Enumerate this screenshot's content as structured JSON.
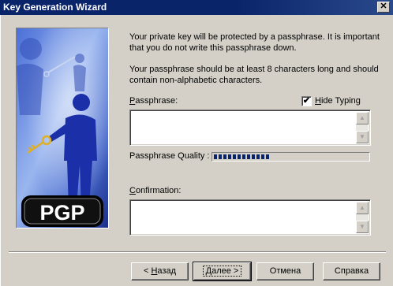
{
  "window": {
    "title": "Key Generation Wizard",
    "close_glyph": "✕"
  },
  "side_image": {
    "logo_text": "PGP"
  },
  "intro": {
    "line1": "Your private key will be protected by a passphrase.  It is important",
    "line2": "that you do not write this passphrase down.",
    "line3": "Your passphrase should be at least 8 characters long and should",
    "line4": "contain non-alphabetic characters."
  },
  "passphrase": {
    "label_first": "P",
    "label_rest": "assphrase:",
    "value": ""
  },
  "hide_typing": {
    "label_first": "H",
    "label_rest": "ide Typing",
    "checked": true,
    "check_glyph": "✔"
  },
  "quality": {
    "label": "Passphrase Quality :",
    "fraction": 0.36
  },
  "confirmation": {
    "label_first": "C",
    "label_rest": "onfirmation:",
    "value": ""
  },
  "scroll_glyphs": {
    "up": "▲",
    "down": "▼"
  },
  "buttons": {
    "back_prefix": "< ",
    "back_first": "Н",
    "back_rest": "азад",
    "next": "Далее >",
    "cancel": "Отмена",
    "help": "Справка"
  }
}
